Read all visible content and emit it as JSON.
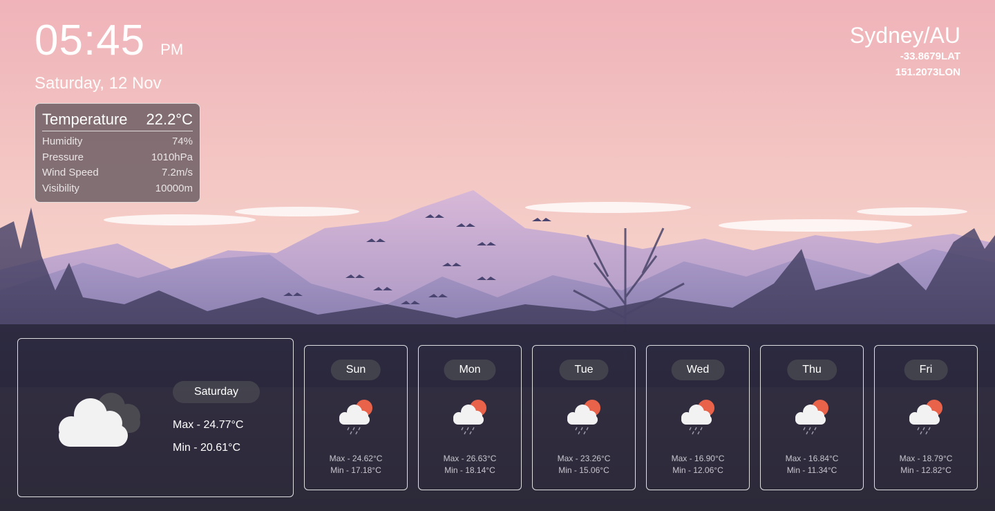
{
  "clock": {
    "time": "05:45",
    "ampm": "PM",
    "date": "Saturday, 12 Nov"
  },
  "location": {
    "city": "Sydney/AU",
    "lat": "-33.8679LAT",
    "lon": "151.2073LON"
  },
  "current": {
    "temperature_label": "Temperature",
    "temperature_value": "22.2°C",
    "rows": [
      {
        "label": "Humidity",
        "value": "74%"
      },
      {
        "label": "Pressure",
        "value": "1010hPa"
      },
      {
        "label": "Wind Speed",
        "value": "7.2m/s"
      },
      {
        "label": "Visibility",
        "value": "10000m"
      }
    ]
  },
  "today": {
    "day": "Saturday",
    "max": "Max - 24.77°C",
    "min": "Min - 20.61°C",
    "icon": "cloudy-icon"
  },
  "forecast": [
    {
      "day": "Sun",
      "max": "Max - 24.62°C",
      "min": "Min - 17.18°C",
      "icon": "rain-sun-icon"
    },
    {
      "day": "Mon",
      "max": "Max - 26.63°C",
      "min": "Min - 18.14°C",
      "icon": "rain-sun-icon"
    },
    {
      "day": "Tue",
      "max": "Max - 23.26°C",
      "min": "Min - 15.06°C",
      "icon": "rain-sun-icon"
    },
    {
      "day": "Wed",
      "max": "Max - 16.90°C",
      "min": "Min - 12.06°C",
      "icon": "rain-sun-icon"
    },
    {
      "day": "Thu",
      "max": "Max - 16.84°C",
      "min": "Min - 11.34°C",
      "icon": "rain-sun-icon"
    },
    {
      "day": "Fri",
      "max": "Max - 18.79°C",
      "min": "Min - 12.82°C",
      "icon": "rain-sun-icon"
    }
  ],
  "colors": {
    "sky_top": "#f2b8bc",
    "sky_bottom": "#f6d7c8",
    "mountain": "#b8a2cc",
    "panel": "#1c1a28",
    "sun": "#e8634a"
  }
}
